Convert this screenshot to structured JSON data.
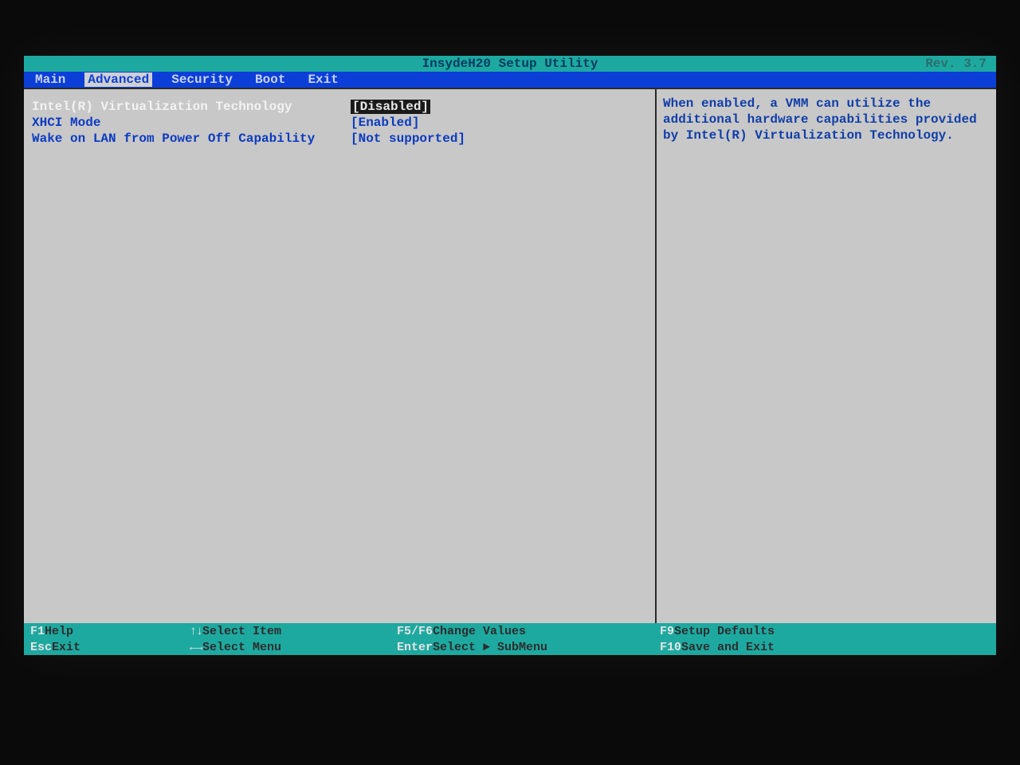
{
  "title_bar": {
    "title": "InsydeH20 Setup Utility",
    "revision": "Rev. 3.7"
  },
  "menu": {
    "items": [
      "Main",
      "Advanced",
      "Security",
      "Boot",
      "Exit"
    ],
    "active_index": 1
  },
  "settings": [
    {
      "label": "Intel(R) Virtualization Technology",
      "value": "[Disabled]",
      "selected": true
    },
    {
      "label": "XHCI Mode",
      "value": "[Enabled]",
      "selected": false
    },
    {
      "label": "Wake on LAN from Power Off Capability",
      "value": "[Not supported]",
      "selected": false
    }
  ],
  "help_text": "When enabled, a VMM can utilize the additional hardware capabilities provided by Intel(R) Virtualization Technology.",
  "footer": {
    "r1c1_key": "F1",
    "r1c1_lbl": "Help",
    "r2c1_key": "Esc",
    "r2c1_lbl": "Exit",
    "r1c2_key": "↑↓",
    "r1c2_lbl": "Select Item",
    "r2c2_key": "←→",
    "r2c2_lbl": "Select Menu",
    "r1c3_key": "F5/F6",
    "r1c3_lbl": "Change Values",
    "r2c3_key": "Enter",
    "r2c3_lbl": "Select ► SubMenu",
    "r1c4_key": "F9",
    "r1c4_lbl": "Setup Defaults",
    "r2c4_key": "F10",
    "r2c4_lbl": "Save and Exit"
  }
}
